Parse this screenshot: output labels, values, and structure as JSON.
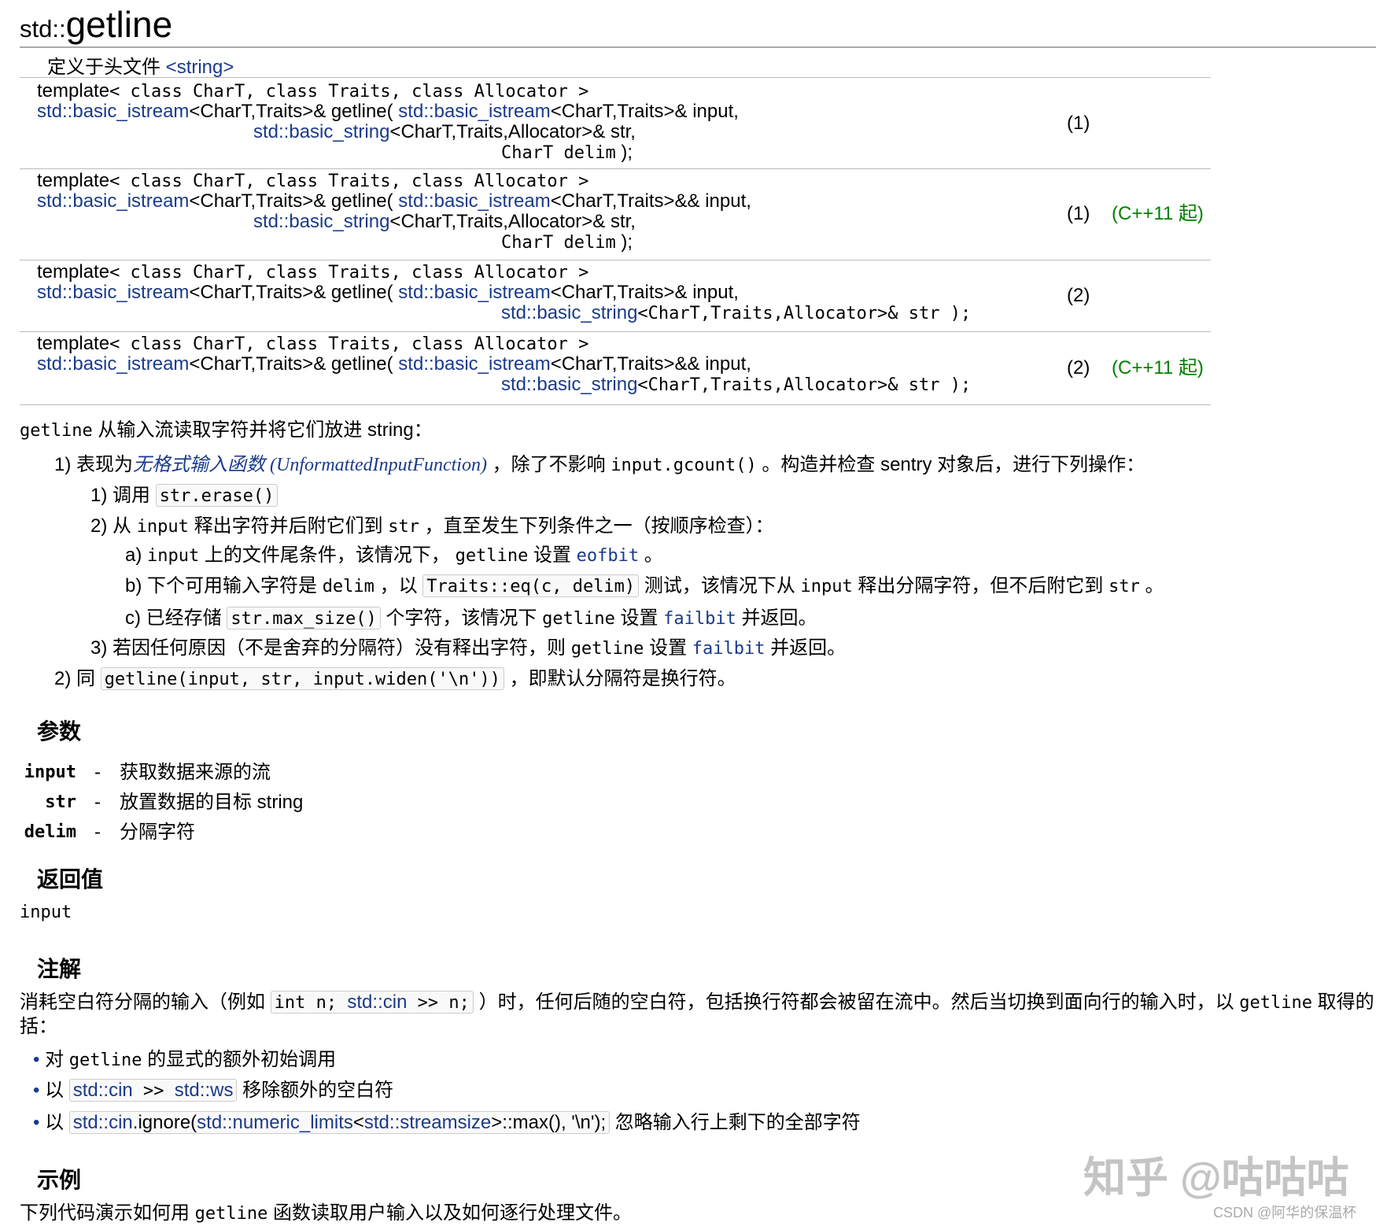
{
  "title": {
    "prefix": "std::",
    "name": "getline"
  },
  "header_line": {
    "label": "定义于头文件 ",
    "header": "<string>"
  },
  "declarations": [
    {
      "num": "(1)",
      "since": "",
      "lines": [
        [
          {
            "t": "template",
            "k": "s"
          },
          {
            "t": "< class CharT, class Traits, class Allocator >",
            "k": "m"
          }
        ],
        [
          {
            "t": "std::basic_istream",
            "k": "l"
          },
          {
            "t": "<CharT,Traits>& getline( ",
            "k": "s"
          },
          {
            "t": "std::basic_istream",
            "k": "l"
          },
          {
            "t": "<CharT,Traits>& input,",
            "k": "s"
          }
        ],
        [
          {
            "t": "std::basic_string",
            "k": "l",
            "ind": 275
          },
          {
            "t": "<CharT,Traits,Allocator>& str,",
            "k": "s"
          }
        ],
        [
          {
            "t": "CharT delim",
            "k": "m",
            "ind": 590
          },
          {
            "t": " );",
            "k": "s"
          }
        ]
      ]
    },
    {
      "num": "(1)",
      "since": "(C++11 起)",
      "lines": [
        [
          {
            "t": "template",
            "k": "s"
          },
          {
            "t": "< class CharT, class Traits, class Allocator >",
            "k": "m"
          }
        ],
        [
          {
            "t": "std::basic_istream",
            "k": "l"
          },
          {
            "t": "<CharT,Traits>& getline( ",
            "k": "s"
          },
          {
            "t": "std::basic_istream",
            "k": "l"
          },
          {
            "t": "<CharT,Traits>&& input,",
            "k": "s"
          }
        ],
        [
          {
            "t": "std::basic_string",
            "k": "l",
            "ind": 275
          },
          {
            "t": "<CharT,Traits,Allocator>& str,",
            "k": "s"
          }
        ],
        [
          {
            "t": "CharT delim",
            "k": "m",
            "ind": 590
          },
          {
            "t": " );",
            "k": "s"
          }
        ]
      ]
    },
    {
      "num": "(2)",
      "since": "",
      "lines": [
        [
          {
            "t": "template",
            "k": "s"
          },
          {
            "t": "< class CharT, class Traits, class Allocator >",
            "k": "m"
          }
        ],
        [
          {
            "t": "std::basic_istream",
            "k": "l"
          },
          {
            "t": "<CharT,Traits>& getline( ",
            "k": "s"
          },
          {
            "t": "std::basic_istream",
            "k": "l"
          },
          {
            "t": "<CharT,Traits>& input,",
            "k": "s"
          }
        ],
        [
          {
            "t": "std::basic_string",
            "k": "l",
            "ind": 590
          },
          {
            "t": "<CharT,Traits,Allocator>& str );",
            "k": "m"
          }
        ]
      ]
    },
    {
      "num": "(2)",
      "since": "(C++11 起)",
      "lines": [
        [
          {
            "t": "template",
            "k": "s"
          },
          {
            "t": "< class CharT, class Traits, class Allocator >",
            "k": "m"
          }
        ],
        [
          {
            "t": "std::basic_istream",
            "k": "l"
          },
          {
            "t": "<CharT,Traits>& getline( ",
            "k": "s"
          },
          {
            "t": "std::basic_istream",
            "k": "l"
          },
          {
            "t": "<CharT,Traits>&& input,",
            "k": "s"
          }
        ],
        [
          {
            "t": "std::basic_string",
            "k": "l",
            "ind": 590
          },
          {
            "t": "<CharT,Traits,Allocator>& str );",
            "k": "m"
          }
        ]
      ]
    }
  ],
  "description": [
    {
      "lvl": 0,
      "seg": [
        {
          "t": "getline",
          "k": "m"
        },
        {
          "t": " 从输入流读取字符并将它们放进 string：",
          "k": "s"
        }
      ]
    },
    {
      "lvl": 1,
      "seg": [
        {
          "t": "1) 表现为",
          "k": "s"
        },
        {
          "t": "无格式输入函数 (UnformattedInputFunction)",
          "k": "li"
        },
        {
          "t": " ，除了不影响 ",
          "k": "s"
        },
        {
          "t": "input.gcount()",
          "k": "m"
        },
        {
          "t": " 。构造并检查 sentry 对象后，进行下列操作：",
          "k": "s"
        }
      ]
    },
    {
      "lvl": 2,
      "seg": [
        {
          "t": "1) 调用 ",
          "k": "s"
        },
        {
          "k": "box",
          "seg": [
            {
              "t": "str.erase()",
              "k": "m"
            }
          ]
        }
      ]
    },
    {
      "lvl": 2,
      "seg": [
        {
          "t": "2) 从 ",
          "k": "s"
        },
        {
          "t": "input",
          "k": "m"
        },
        {
          "t": " 释出字符并后附它们到 ",
          "k": "s"
        },
        {
          "t": "str",
          "k": "m"
        },
        {
          "t": " ，直至发生下列条件之一（按顺序检查）：",
          "k": "s"
        }
      ]
    },
    {
      "lvl": 3,
      "seg": [
        {
          "t": "a) ",
          "k": "s"
        },
        {
          "t": "input",
          "k": "m"
        },
        {
          "t": " 上的文件尾条件，该情况下， ",
          "k": "s"
        },
        {
          "t": "getline",
          "k": "m"
        },
        {
          "t": " 设置 ",
          "k": "s"
        },
        {
          "t": "eofbit",
          "k": "lm"
        },
        {
          "t": " 。",
          "k": "s"
        }
      ]
    },
    {
      "lvl": 3,
      "seg": [
        {
          "t": "b) 下个可用输入字符是 ",
          "k": "s"
        },
        {
          "t": "delim",
          "k": "m"
        },
        {
          "t": " ，以 ",
          "k": "s"
        },
        {
          "k": "box",
          "seg": [
            {
              "t": "Traits::eq(c, delim)",
              "k": "m"
            }
          ]
        },
        {
          "t": " 测试，该情况下从 ",
          "k": "s"
        },
        {
          "t": "input",
          "k": "m"
        },
        {
          "t": " 释出分隔字符，但不后附它到 ",
          "k": "s"
        },
        {
          "t": "str",
          "k": "m"
        },
        {
          "t": " 。",
          "k": "s"
        }
      ]
    },
    {
      "lvl": 3,
      "seg": [
        {
          "t": "c) 已经存储 ",
          "k": "s"
        },
        {
          "k": "box",
          "seg": [
            {
              "t": "str.max_size()",
              "k": "m"
            }
          ]
        },
        {
          "t": " 个字符，该情况下 ",
          "k": "s"
        },
        {
          "t": "getline",
          "k": "m"
        },
        {
          "t": " 设置 ",
          "k": "s"
        },
        {
          "t": "failbit",
          "k": "lm"
        },
        {
          "t": " 并返回。",
          "k": "s"
        }
      ]
    },
    {
      "lvl": 2,
      "seg": [
        {
          "t": "3) 若因任何原因（不是舍弃的分隔符）没有释出字符，则 ",
          "k": "s"
        },
        {
          "t": "getline",
          "k": "m"
        },
        {
          "t": " 设置 ",
          "k": "s"
        },
        {
          "t": "failbit",
          "k": "lm"
        },
        {
          "t": " 并返回。",
          "k": "s"
        }
      ]
    },
    {
      "lvl": 1,
      "seg": [
        {
          "t": "2) 同 ",
          "k": "s"
        },
        {
          "k": "box",
          "seg": [
            {
              "t": "getline(input, str, input.widen('\\n'))",
              "k": "m"
            }
          ]
        },
        {
          "t": " ，即默认分隔符是换行符。",
          "k": "s"
        }
      ]
    }
  ],
  "params": {
    "heading": "参数",
    "items": [
      {
        "name": "input",
        "dash": "-",
        "desc": "获取数据来源的流"
      },
      {
        "name": "str",
        "dash": "-",
        "desc": "放置数据的目标 string"
      },
      {
        "name": "delim",
        "dash": "-",
        "desc": "分隔字符"
      }
    ]
  },
  "return": {
    "heading": "返回值",
    "value": "input"
  },
  "notes": {
    "heading": "注解",
    "para": [
      {
        "t": "消耗空白符分隔的输入（例如 ",
        "k": "s"
      },
      {
        "k": "box",
        "seg": [
          {
            "t": "int n; ",
            "k": "m"
          },
          {
            "t": "std::cin",
            "k": "l"
          },
          {
            "t": " >> n;",
            "k": "m"
          }
        ]
      },
      {
        "t": " ）时，任何后随的空白符，包括换行符都会被留在流中。然后当切换到面向行的输入时，以 ",
        "k": "s"
      },
      {
        "t": "getline",
        "k": "m"
      },
      {
        "t": " 取得的",
        "k": "s"
      }
    ],
    "para2": "括：",
    "bullets": [
      [
        {
          "t": "对 ",
          "k": "s"
        },
        {
          "t": "getline",
          "k": "m"
        },
        {
          "t": " 的显式的额外初始调用",
          "k": "s"
        }
      ],
      [
        {
          "t": "以 ",
          "k": "s"
        },
        {
          "k": "box",
          "seg": [
            {
              "t": "std::cin",
              "k": "l"
            },
            {
              "t": " >> ",
              "k": "m"
            },
            {
              "t": "std::ws",
              "k": "l"
            }
          ]
        },
        {
          "t": " 移除额外的空白符",
          "k": "s"
        }
      ],
      [
        {
          "t": "以 ",
          "k": "s"
        },
        {
          "k": "box",
          "seg": [
            {
              "t": "std::cin",
              "k": "l"
            },
            {
              "t": ".ignore(",
              "k": "s"
            },
            {
              "t": "std::numeric_limits",
              "k": "l"
            },
            {
              "t": "<",
              "k": "s"
            },
            {
              "t": "std::streamsize",
              "k": "l"
            },
            {
              "t": ">::max(), '\\n');",
              "k": "s"
            }
          ]
        },
        {
          "t": " 忽略输入行上剩下的全部字符",
          "k": "s"
        }
      ]
    ]
  },
  "example": {
    "heading": "示例",
    "text_before": "下列代码演示如何用 ",
    "code": "getline",
    "text_after": " 函数读取用户输入以及如何逐行处理文件。"
  },
  "watermarks": {
    "zhihu": "知乎 @咕咕咕",
    "csdn": "CSDN @阿华的保温杯"
  },
  "colors": {
    "link": "#1a3a8a",
    "since": "#008000"
  }
}
